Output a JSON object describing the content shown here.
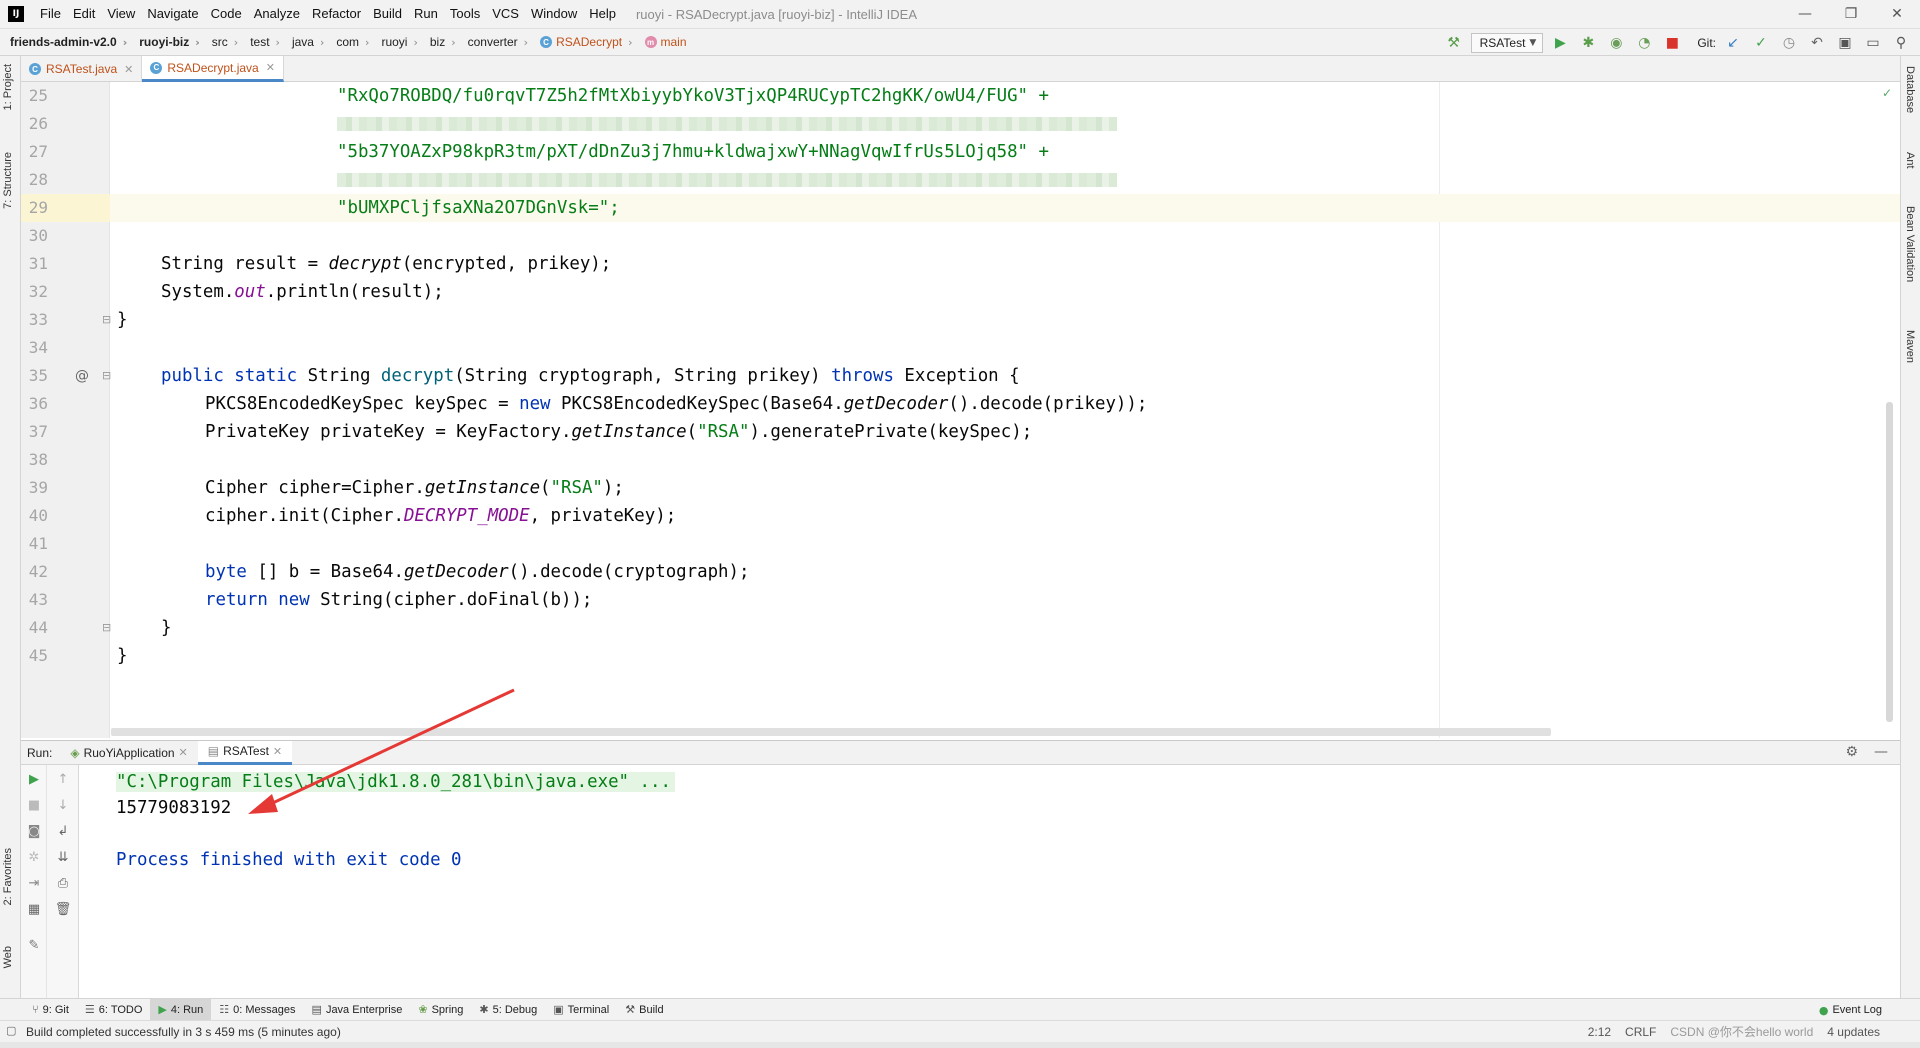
{
  "window": {
    "title": "ruoyi - RSADecrypt.java [ruoyi-biz] - IntelliJ IDEA",
    "app_icon_text": "IJ",
    "controls": [
      "—",
      "❐",
      "✕"
    ]
  },
  "menu": [
    "File",
    "Edit",
    "View",
    "Navigate",
    "Code",
    "Analyze",
    "Refactor",
    "Build",
    "Run",
    "Tools",
    "VCS",
    "Window",
    "Help"
  ],
  "breadcrumb": {
    "project": "friends-admin-v2.0",
    "module": "ruoyi-biz",
    "dirs": [
      "src",
      "test",
      "java",
      "com",
      "ruoyi",
      "biz",
      "converter"
    ],
    "class": "RSADecrypt",
    "method": "main"
  },
  "toolbar": {
    "run_config": "RSATest",
    "git_label": "Git:"
  },
  "editor_tabs": [
    {
      "label": "RSATest.java",
      "active": false
    },
    {
      "label": "RSADecrypt.java",
      "active": true
    }
  ],
  "left_stripe": {
    "project": "1: Project",
    "structure": "7: Structure",
    "favorites": "2: Favorites",
    "web": "Web"
  },
  "right_stripe": {
    "database": "Database",
    "ant": "Ant",
    "bean_validation": "Bean Validation",
    "maven": "Maven"
  },
  "code": {
    "l25": "\"RxQo7ROBDQ/fu0rqvT7Z5h2fMtXbiyybYkoV3TjxQP4RUCypTC2hgKK/owU4/FUG\" +",
    "l27": "\"5b37YOAZxP98kpR3tm/pXT/dDnZu3j7hmu+kldwajxwY+NNagVqwIfrUs5LOjq58\" +",
    "l29": "\"bUMXPCljfsaXNa2O7DGnVsk=\";",
    "l31_a": "String result = ",
    "l31_b": "decrypt",
    "l31_c": "(encrypted, prikey);",
    "l32_a": "System.",
    "l32_b": "out",
    "l32_c": ".println(result);",
    "l33": "}",
    "l35_a": "public static ",
    "l35_b": "String ",
    "l35_c": "decrypt",
    "l35_d": "(String cryptograph, String prikey) ",
    "l35_e": "throws ",
    "l35_f": "Exception {",
    "l36_a": "PKCS8EncodedKeySpec keySpec = ",
    "l36_b": "new ",
    "l36_c": "PKCS8EncodedKeySpec(Base64.",
    "l36_d": "getDecoder",
    "l36_e": "().decode(prikey));",
    "l37_a": "PrivateKey privateKey = KeyFactory.",
    "l37_b": "getInstance",
    "l37_c": "(",
    "l37_d": "\"RSA\"",
    "l37_e": ").generatePrivate(keySpec);",
    "l39_a": "Cipher cipher=Cipher.",
    "l39_b": "getInstance",
    "l39_c": "(",
    "l39_d": "\"RSA\"",
    "l39_e": ");",
    "l40_a": "cipher.init(Cipher.",
    "l40_b": "DECRYPT_MODE",
    "l40_c": ", privateKey);",
    "l42_a": "byte ",
    "l42_b": "[] b = Base64.",
    "l42_c": "getDecoder",
    "l42_d": "().decode(cryptograph);",
    "l43_a": "return new ",
    "l43_b": "String(cipher.doFinal(b));",
    "l44": "}",
    "l45": "}",
    "override_marker": "@"
  },
  "line_numbers": [
    "25",
    "26",
    "27",
    "28",
    "29",
    "30",
    "31",
    "32",
    "33",
    "34",
    "35",
    "36",
    "37",
    "38",
    "39",
    "40",
    "41",
    "42",
    "43",
    "44",
    "45"
  ],
  "run_window": {
    "label": "Run:",
    "tabs": [
      {
        "label": "RuoYiApplication",
        "active": false
      },
      {
        "label": "RSATest",
        "active": true
      }
    ],
    "console": {
      "command": "\"C:\\Program Files\\Java\\jdk1.8.0_281\\bin\\java.exe\" ...",
      "output": "15779083192",
      "exit": "Process finished with exit code 0"
    }
  },
  "bottom_tools": [
    {
      "label": "9: Git",
      "icon": "git-icon"
    },
    {
      "label": "6: TODO",
      "icon": "todo-icon"
    },
    {
      "label": "4: Run",
      "icon": "run-icon",
      "active": true
    },
    {
      "label": "0: Messages",
      "icon": "messages-icon"
    },
    {
      "label": "Java Enterprise",
      "icon": "java-enterprise-icon"
    },
    {
      "label": "Spring",
      "icon": "spring-icon"
    },
    {
      "label": "5: Debug",
      "icon": "debug-icon"
    },
    {
      "label": "Terminal",
      "icon": "terminal-icon"
    },
    {
      "label": "Build",
      "icon": "build-icon"
    }
  ],
  "event_log": "Event Log",
  "status": {
    "message": "Build completed successfully in 3 s 459 ms (5 minutes ago)",
    "position": "2:12",
    "line_sep": "CRLF",
    "watermark": "CSDN @你不会hello world",
    "updates": "4 updates"
  },
  "colors": {
    "keyword": "#0033b3",
    "string": "#067d17",
    "function": "#00627a",
    "static_field": "#871094",
    "arrow": "#e53935"
  }
}
